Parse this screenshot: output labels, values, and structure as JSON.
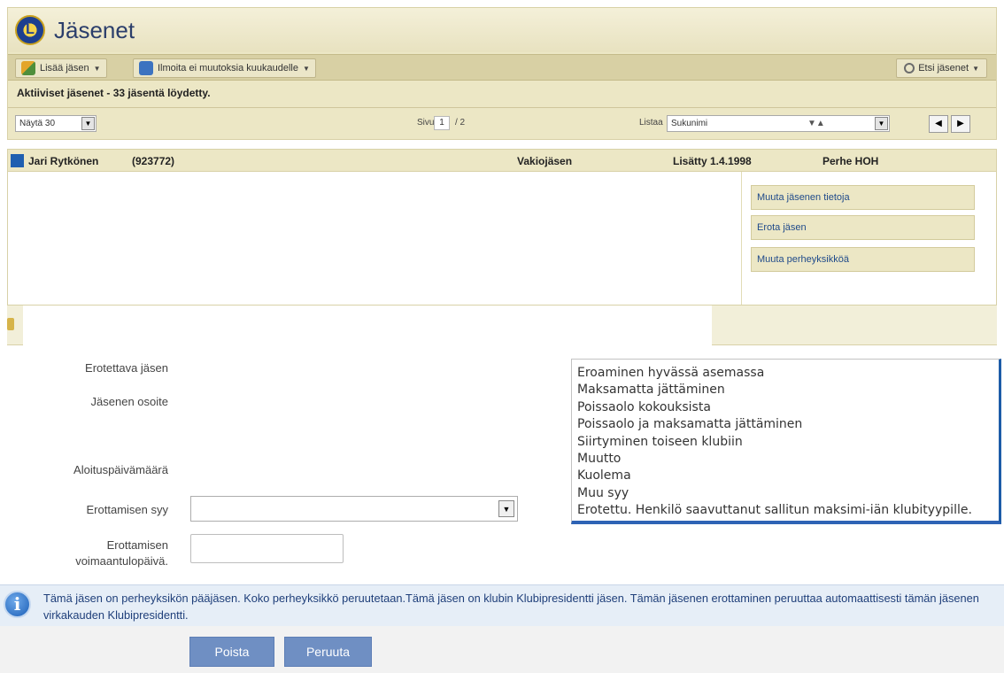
{
  "app": {
    "title": "Jäsenet",
    "logo_letter": "L"
  },
  "toolbar": {
    "add_member": "Lisää jäsen",
    "report_no_changes": "Ilmoita ei muutoksia kuukaudelle",
    "search_members": "Etsi jäsenet"
  },
  "results": {
    "label": "Aktiiviset jäsenet - 33 jäsentä löydetty."
  },
  "pager": {
    "show_value": "Näytä 30",
    "page_label": "Sivu",
    "page_current": "1",
    "page_total": "/ 2",
    "sort_label": "Listaa",
    "sort_value": "Sukunimi",
    "sort_icon": "▼▲",
    "prev": "◀",
    "next": "▶"
  },
  "member": {
    "name": "Jari Rytkönen",
    "id": "(923772)",
    "type": "Vakiojäsen",
    "added": "Lisätty 1.4.1998",
    "family": "Perhe HOH",
    "actions": [
      "Muuta jäsenen tietoja",
      "Erota jäsen",
      "Muuta perheyksikköä"
    ]
  },
  "form": {
    "member_label": "Erotettava jäsen",
    "address_label": "Jäsenen osoite",
    "start_date_label": "Aloituspäivämäärä",
    "reason_label": "Erottamisen syy",
    "effective_label_1": "Erottamisen",
    "effective_label_2": "voimaantulopäivä.",
    "reason_options": [
      "Eroaminen hyvässä asemassa",
      "Maksamatta jättäminen",
      "Poissaolo kokouksista",
      "Poissaolo ja maksamatta jättäminen",
      "Siirtyminen toiseen klubiin",
      "Muutto",
      "Kuolema",
      "Muu syy",
      "Erotettu. Henkilö saavuttanut sallitun maksimi-iän klubityypille."
    ]
  },
  "info": {
    "icon": "i",
    "text": "Tämä jäsen on perheyksikön pääjäsen. Koko perheyksikkö peruutetaan.Tämä jäsen on klubin Klubipresidentti jäsen. Tämän jäsenen erottaminen peruuttaa automaattisesti tämän jäsenen virkakauden Klubipresidentti."
  },
  "buttons": {
    "delete": "Poista",
    "cancel": "Peruuta"
  },
  "colors": {
    "panel_bg": "#ece7c5",
    "accent_blue": "#6f8fc3",
    "listbox_border": "#1d5ca8",
    "info_bg": "#e6eef7"
  }
}
